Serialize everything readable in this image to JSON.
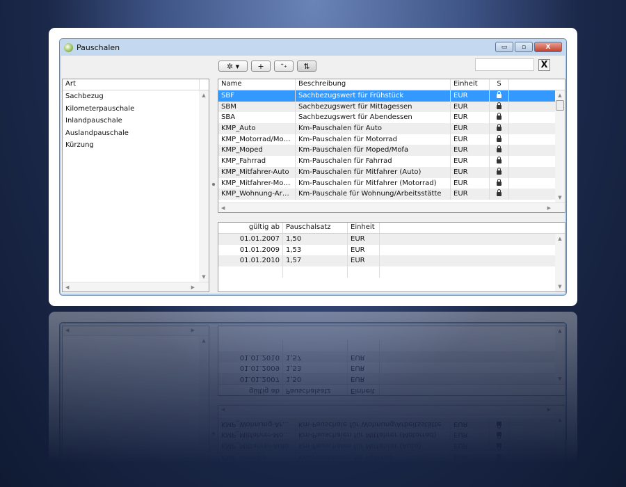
{
  "window": {
    "title": "Pauschalen",
    "minimize": "▭",
    "maximize": "▫",
    "close": "X"
  },
  "toolbar": {
    "settings": "✲ ▾",
    "add": "+",
    "add_multi": "⁺₊",
    "sort": "⇅",
    "search_value": "",
    "clear": "X"
  },
  "left": {
    "header": "Art",
    "items": [
      "Sachbezug",
      "Kilometerpauschale",
      "Inlandpauschale",
      "Auslandpauschale",
      "Kürzung"
    ]
  },
  "main": {
    "columns": [
      "Name",
      "Beschreibung",
      "Einheit",
      "S"
    ],
    "rows": [
      {
        "name": "SBF",
        "desc": "Sachbezugswert für Frühstück",
        "unit": "EUR"
      },
      {
        "name": "SBM",
        "desc": "Sachbezugswert für Mittagessen",
        "unit": "EUR"
      },
      {
        "name": "SBA",
        "desc": "Sachbezugswert für Abendessen",
        "unit": "EUR"
      },
      {
        "name": "KMP_Auto",
        "desc": "Km-Pauschalen für Auto",
        "unit": "EUR"
      },
      {
        "name": "KMP_Motorrad/Mot...",
        "desc": "Km-Pauschalen für Motorrad",
        "unit": "EUR"
      },
      {
        "name": "KMP_Moped",
        "desc": "Km-Pauschalen für Moped/Mofa",
        "unit": "EUR"
      },
      {
        "name": "KMP_Fahrrad",
        "desc": "Km-Pauschalen für Fahrrad",
        "unit": "EUR"
      },
      {
        "name": "KMP_Mitfahrer-Auto",
        "desc": "Km-Pauschalen für Mitfahrer (Auto)",
        "unit": "EUR"
      },
      {
        "name": "KMP_Mitfahrer-Mot...",
        "desc": "Km-Pauschalen für Mitfahrer (Motorrad)",
        "unit": "EUR"
      },
      {
        "name": "KMP_Wohnung-Arbeit",
        "desc": "Km-Pauschale für Wohnung/Arbeitsstätte",
        "unit": "EUR"
      }
    ]
  },
  "detail": {
    "columns": [
      "gültig ab",
      "Pauschalsatz",
      "Einheit"
    ],
    "rows": [
      {
        "date": "01.01.2007",
        "rate": "1,50",
        "unit": "EUR"
      },
      {
        "date": "01.01.2009",
        "rate": "1,53",
        "unit": "EUR"
      },
      {
        "date": "01.01.2010",
        "rate": "1,57",
        "unit": "EUR"
      }
    ]
  }
}
